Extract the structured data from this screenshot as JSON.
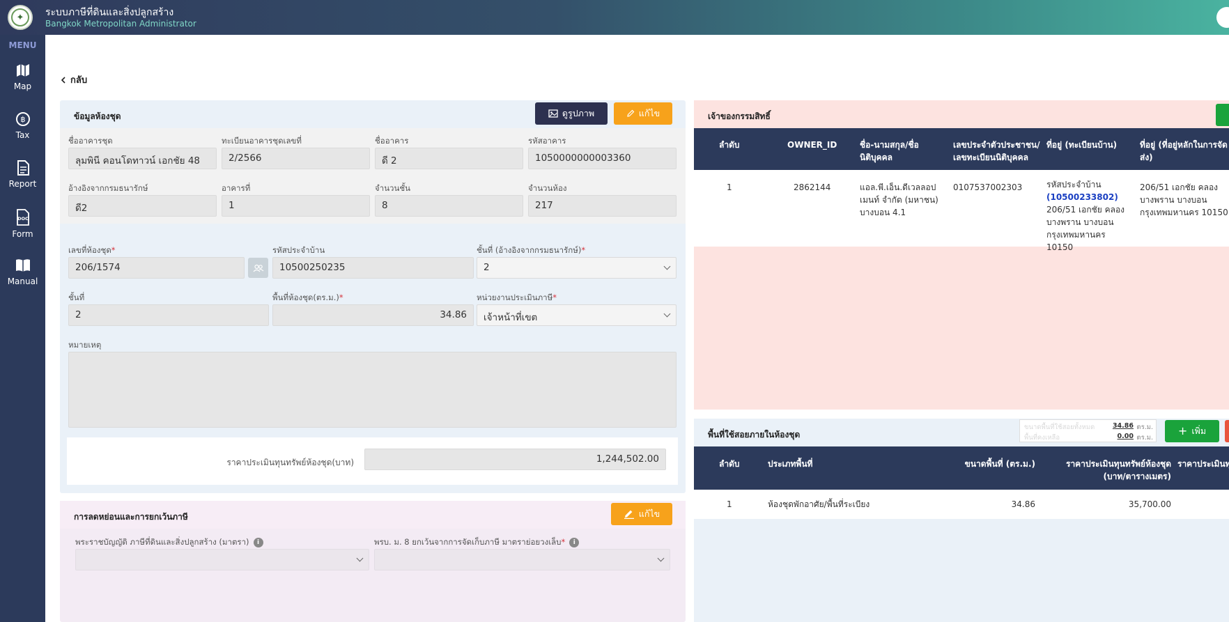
{
  "app": {
    "title": "ระบบภาษีที่ดินและสิ่งปลูกสร้าง",
    "subtitle": "Bangkok Metropolitan Administrator"
  },
  "sidebar": {
    "menu_label": "MENU",
    "items": [
      {
        "label": "Map",
        "icon": "map-icon"
      },
      {
        "label": "Tax",
        "icon": "coin-icon"
      },
      {
        "label": "Report",
        "icon": "document-icon"
      },
      {
        "label": "Form",
        "icon": "doc-file-icon"
      },
      {
        "label": "Manual",
        "icon": "book-icon"
      }
    ]
  },
  "back_label": "กลับ",
  "condo_info": {
    "title": "ข้อมูลห้องชุด",
    "view_image_label": "ดูรูปภาพ",
    "edit_label": "แก้ไข",
    "fields": {
      "condo_name": {
        "label": "ชื่ออาคารชุด",
        "value": "ลุมพินี คอนโดทาวน์ เอกชัย 48"
      },
      "registration_no": {
        "label": "ทะเบียนอาคารชุดเลขที่",
        "value": "2/2566"
      },
      "building_name": {
        "label": "ชื่ออาคาร",
        "value": "ดี 2"
      },
      "building_code": {
        "label": "รหัสอาคาร",
        "value": "1050000000003360"
      },
      "ref_treasury": {
        "label": "อ้างอิงจากกรมธนารักษ์",
        "value": "ดี2"
      },
      "building_no": {
        "label": "อาคารที่",
        "value": "1"
      },
      "floors_count": {
        "label": "จำนวนชั้น",
        "value": "8"
      },
      "rooms_count": {
        "label": "จำนวนห้อง",
        "value": "217"
      }
    }
  },
  "room": {
    "room_no": {
      "label": "เลขที่ห้องชุด",
      "value": "206/1574"
    },
    "house_code": {
      "label": "รหัสประจำบ้าน",
      "value": "10500250235"
    },
    "floor_ref": {
      "label": "ชั้นที่ (อ้างอิงจากกรมธนารักษ์)",
      "value": "2"
    },
    "floor": {
      "label": "ชั้นที่",
      "value": "2"
    },
    "area": {
      "label": "พื้นที่ห้องชุด(ตร.ม.)",
      "value": "34.86"
    },
    "assess_unit": {
      "label": "หน่วยงานประเมินภาษี",
      "value": "เจ้าหน้าที่เขต"
    },
    "remark": {
      "label": "หมายเหตุ",
      "value": ""
    },
    "appraisal": {
      "label": "ราคาประเมินทุนทรัพย์ห้องชุด(บาท)",
      "value": "1,244,502.00"
    }
  },
  "discount": {
    "title": "การลดหย่อนและการยกเว้นภาษี",
    "edit_label": "แก้ไข",
    "act_label": "พระราชบัญญัติ ภาษีที่ดินและสิ่งปลูกสร้าง (มาตรา)",
    "decree_label": "พรบ. ม. 8 ยกเว้นจากการจัดเก็บภาษี มาตราย่อยวงเล็บ"
  },
  "owners": {
    "title": "เจ้าของกรรมสิทธิ์",
    "columns": [
      "ลำดับ",
      "OWNER_ID",
      "ชื่อ-นามสกุล/ชื่อนิติบุคคล",
      "เลขประจำตัวประชาชน/เลขทะเบียนนิติบุคคล",
      "ที่อยู่ (ทะเบียนบ้าน)",
      "ที่อยู่ (ที่อยู่หลักในการจัดส่ง)"
    ],
    "rows": [
      {
        "no": "1",
        "owner_id": "2862144",
        "name": "แอล.พี.เอ็น.ดีเวลลอปเมนท์ จำกัด (มหาชน) บางบอน 4.1",
        "tax_id": "0107537002303",
        "house_code_label": "รหัสประจำบ้าน",
        "house_code": "(10500233802)",
        "address": "206/51 เอกชัย คลองบางพราน บางบอน กรุงเทพมหานคร 10150",
        "mail_address": "206/51 เอกชัย คลองบางพราน บางบอน กรุงเทพมหานคร 10150"
      }
    ]
  },
  "usage": {
    "title": "พื้นที่ใช้สอยภายในห้องชุด",
    "summary_used_label": "ขนาดพื้นที่ใช้สอยทั้งหมด",
    "summary_used_value": "34.86",
    "summary_remain_label": "พื้นที่คงเหลือ",
    "summary_remain_value": "0.00",
    "unit": "ตร.ม.",
    "add_label": "เพิ่ม",
    "columns": [
      "ลำดับ",
      "ประเภทพื้นที่",
      "ขนาดพื้นที่ (ตร.ม.)",
      "ราคาประเมินทุนทรัพย์ห้องชุด (บาท/ตารางเมตร)",
      "ราคาประเมินทุ"
    ],
    "rows": [
      {
        "no": "1",
        "type": "ห้องชุดพักอาศัย/พื้นที่ระเบียง",
        "area": "34.86",
        "price": "35,700.00"
      }
    ]
  },
  "colors": {
    "sidebar": "#2c3a5b",
    "panel_blue": "#eaf1f8",
    "panel_pink": "#fde3e0",
    "panel_lavender": "#f3ebf4",
    "orange": "#f7a21b",
    "green": "#1aa33b"
  }
}
